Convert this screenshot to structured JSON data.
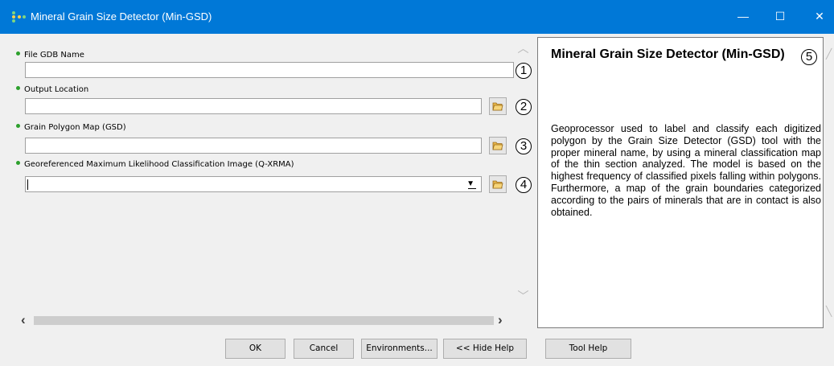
{
  "window": {
    "title": "Mineral Grain Size Detector (Min-GSD)",
    "minimize_glyph": "—",
    "maximize_glyph": "☐",
    "close_glyph": "✕"
  },
  "parameters": [
    {
      "label": "File GDB Name",
      "value": "",
      "type": "text",
      "marker": "1"
    },
    {
      "label": "Output Location",
      "value": "",
      "type": "folder",
      "marker": "2"
    },
    {
      "label": "Grain Polygon Map (GSD)",
      "value": "",
      "type": "file",
      "marker": "3"
    },
    {
      "label": "Georeferenced Maximum Likelihood Classification Image (Q-XRMA)",
      "value": "",
      "type": "dropdown",
      "marker": "4"
    }
  ],
  "help": {
    "marker": "5",
    "title": "Mineral Grain Size Detector (Min-GSD)",
    "body": "Geoprocessor used to label and classify each digitized polygon by the Grain Size Detector (GSD) tool with the proper mineral name, by using a mineral classification map of the thin section analyzed. The model is based on the highest frequency of classified pixels falling within polygons. Furthermore, a map of the grain boundaries categorized according to the pairs of minerals that are in contact is also obtained."
  },
  "buttons": {
    "ok": "OK",
    "cancel": "Cancel",
    "environments": "Environments...",
    "hide_help": "<< Hide Help",
    "tool_help": "Tool Help"
  },
  "colors": {
    "titlebar": "#0078d7",
    "required_dot": "#2ca02c",
    "folder_icon": "#e8b64a"
  },
  "icons": {
    "browse": "folder-open-icon",
    "dropdown": "chevron-down-icon",
    "app": "model-tool-icon"
  }
}
